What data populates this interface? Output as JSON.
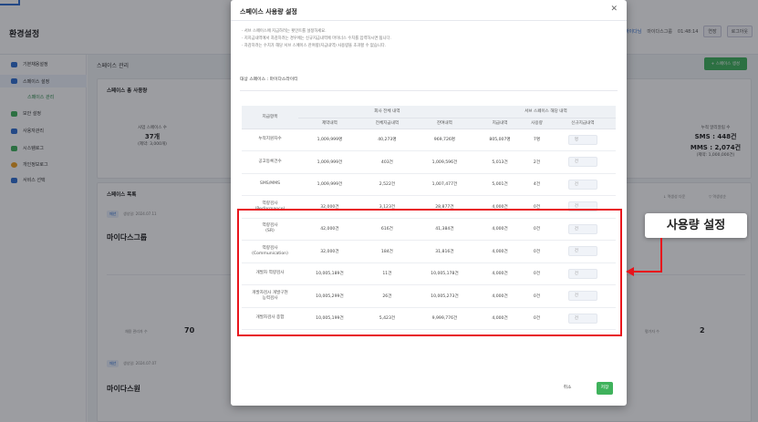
{
  "app": {
    "title": "환경설정",
    "user_name": "마이다님",
    "company": "마이다스그룹",
    "time": "01:48:14",
    "extend_label": "연장",
    "logout_label": "로그아웃"
  },
  "sidebar": {
    "items": [
      {
        "label": "기본채용설정",
        "icon": "settings-icon",
        "color": "#2f6fd1"
      },
      {
        "label": "스페이스 설정",
        "icon": "space-icon",
        "color": "#2f6fd1"
      },
      {
        "label": "보안 설정",
        "icon": "lock-icon",
        "color": "#3fb25c"
      },
      {
        "label": "사용자관리",
        "icon": "user-icon",
        "color": "#2f6fd1"
      },
      {
        "label": "시스템로그",
        "icon": "log-icon",
        "color": "#3fb25c"
      },
      {
        "label": "개인정보로그",
        "icon": "privacy-icon",
        "color": "#f0a020"
      },
      {
        "label": "서비스 선택",
        "icon": "grid-icon",
        "color": "#2f6fd1"
      }
    ],
    "sub_item": "스페이스 관리"
  },
  "main": {
    "page_title": "스페이스 관리",
    "add_button": "+ 스페이스 생성",
    "summary": {
      "title": "스페이스 총 사용량",
      "stat_left_label": "사업 스페이스 수",
      "stat_left_value": "37개",
      "stat_left_sub": "(제약: 3,000개)",
      "sms_label": "누적 알리알림 수",
      "sms_value": "SMS : 448건",
      "mms_value": "MMS : 2,074건",
      "sms_sub": "(제약: 1,000,000건)"
    },
    "list": {
      "title": "스페이스 목록",
      "sort_label": "↓ 역생성 다운",
      "filter_label": "▽ 역생성순",
      "space1_tag": "매년",
      "space1_date": "생성일: 2024.07.11",
      "space1_name": "마이다스그룹",
      "space1_count_label": "채용 관리자 수",
      "space1_count": "70",
      "space1_stat_label": "평가자 수",
      "space1_stat": "2",
      "space2_tag": "매년",
      "space2_date": "생성일: 2024.07.07",
      "space2_name": "마이다스원"
    }
  },
  "modal": {
    "title": "스페이스 사용량 설정",
    "notes": [
      "· 서브 스페이스에 지급하려는 횟인트를 설정하세요.",
      "· 지지급내역에서 차감하려는 경우에는 신규지급내역에 마이너스 수치를 입력하시면 됩니다.",
      "· 차감하려는 수치가 해당 서브 스페이스 잔여량(지급내역) 사용량을 초과할 수 없습니다."
    ],
    "target_label": "대상 스페이스 : 마이다스라이티",
    "table": {
      "col_item": "지급항목",
      "group_company": "회사 전체 내역",
      "group_sub": "서브 스페이스 해당 내역",
      "sub_headers": [
        "제약내역",
        "전체지급내역",
        "잔여내역",
        "지급내역",
        "사용량",
        "신규지급내역"
      ],
      "rows": [
        {
          "label": "누적지원자수",
          "limit": "1,009,999명",
          "total": "40,273명",
          "remain": "969,726명",
          "granted": "805,007명",
          "used": "7명",
          "placeholder": "명"
        },
        {
          "label": "공고등록건수",
          "limit": "1,009,999건",
          "total": "403건",
          "remain": "1,009,596건",
          "granted": "5,013건",
          "used": "2건",
          "placeholder": "건"
        },
        {
          "label": "SMS/MMS",
          "limit": "1,009,999건",
          "total": "2,522건",
          "remain": "1,007,477건",
          "granted": "5,001건",
          "used": "4건",
          "placeholder": "건"
        },
        {
          "label": "역량검사\n(Performance)",
          "limit": "32,000건",
          "total": "3,123건",
          "remain": "28,877건",
          "granted": "4,000건",
          "used": "0건",
          "placeholder": "건"
        },
        {
          "label": "역량검사\n(SR)",
          "limit": "42,000건",
          "total": "616건",
          "remain": "41,384건",
          "granted": "4,000건",
          "used": "0건",
          "placeholder": "건"
        },
        {
          "label": "역량검사\n(Communication)",
          "limit": "32,000건",
          "total": "184건",
          "remain": "31,816건",
          "granted": "4,000건",
          "used": "0건",
          "placeholder": "건"
        },
        {
          "label": "개발자 역량검사",
          "limit": "10,005,189건",
          "total": "11건",
          "remain": "10,005,178건",
          "granted": "4,000건",
          "used": "0건",
          "placeholder": "건"
        },
        {
          "label": "개발자검사 개발구현\n능력검사",
          "limit": "10,005,299건",
          "total": "26건",
          "remain": "10,005,273건",
          "granted": "4,000건",
          "used": "0건",
          "placeholder": "건"
        },
        {
          "label": "개발자검사 종합",
          "limit": "10,005,199건",
          "total": "5,423건",
          "remain": "9,999,776건",
          "granted": "4,000건",
          "used": "0건",
          "placeholder": "건"
        }
      ]
    },
    "cancel_label": "취소",
    "save_label": "저장"
  },
  "callout": {
    "label": "사용량 설정",
    "color": "#e8141c"
  }
}
